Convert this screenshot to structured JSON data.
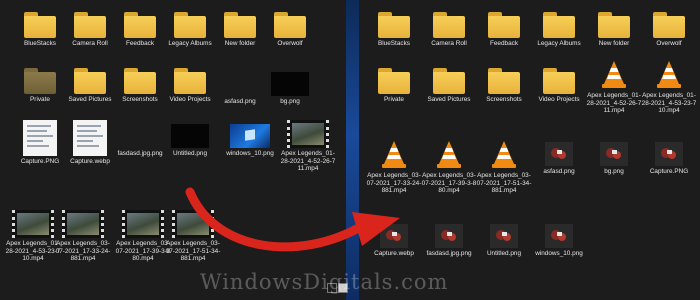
{
  "left_pane": {
    "items": [
      {
        "label": "BlueStacks",
        "kind": "folder"
      },
      {
        "label": "Camera Roll",
        "kind": "folder"
      },
      {
        "label": "Feedback",
        "kind": "folder"
      },
      {
        "label": "Legacy Albums",
        "kind": "folder"
      },
      {
        "label": "New folder",
        "kind": "folder"
      },
      {
        "label": "Overwolf",
        "kind": "folder"
      },
      {
        "label": "Private",
        "kind": "folder-dim"
      },
      {
        "label": "Saved Pictures",
        "kind": "folder"
      },
      {
        "label": "Screenshots",
        "kind": "folder"
      },
      {
        "label": "Video Projects",
        "kind": "folder"
      },
      {
        "label": "asfasd.png",
        "kind": "none"
      },
      {
        "label": "bg.png",
        "kind": "black"
      },
      {
        "label": "Capture.PNG",
        "kind": "doc"
      },
      {
        "label": "Capture.webp",
        "kind": "doc"
      },
      {
        "label": "fasdasd.jpg.png",
        "kind": "none"
      },
      {
        "label": "Untitled.png",
        "kind": "black"
      },
      {
        "label": "windows_10.png",
        "kind": "win10"
      },
      {
        "label": "Apex Legends_01-28-2021_4-52-26-711.mp4",
        "kind": "video"
      },
      {
        "label": "Apex Legends_01-28-2021_4-53-23-710.mp4",
        "kind": "video"
      },
      {
        "label": "Apex Legends_03-07-2021_17-33-24-881.mp4",
        "kind": "video"
      },
      {
        "label": "Apex Legends_03-07-2021_17-39-3-880.mp4",
        "kind": "video"
      },
      {
        "label": "Apex Legends_03-07-2021_17-51-34-881.mp4",
        "kind": "video"
      }
    ]
  },
  "right_pane": {
    "items": [
      {
        "label": "BlueStacks",
        "kind": "folder"
      },
      {
        "label": "Camera Roll",
        "kind": "folder"
      },
      {
        "label": "Feedback",
        "kind": "folder"
      },
      {
        "label": "Legacy Albums",
        "kind": "folder"
      },
      {
        "label": "New folder",
        "kind": "folder"
      },
      {
        "label": "Overwolf",
        "kind": "folder"
      },
      {
        "label": "Private",
        "kind": "folder"
      },
      {
        "label": "Saved Pictures",
        "kind": "folder"
      },
      {
        "label": "Screenshots",
        "kind": "folder"
      },
      {
        "label": "Video Projects",
        "kind": "folder"
      },
      {
        "label": "Apex Legends_01-28-2021_4-52-26-711.mp4",
        "kind": "vlc"
      },
      {
        "label": "Apex Legends_01-28-2021_4-53-23-710.mp4",
        "kind": "vlc"
      },
      {
        "label": "Apex Legends_03-07-2021_17-33-24-881.mp4",
        "kind": "vlc"
      },
      {
        "label": "Apex Legends_03-07-2021_17-39-3-880.mp4",
        "kind": "vlc"
      },
      {
        "label": "Apex Legends_03-07-2021_17-51-34-881.mp4",
        "kind": "vlc"
      },
      {
        "label": "asfasd.png",
        "kind": "ph"
      },
      {
        "label": "bg.png",
        "kind": "ph"
      },
      {
        "label": "Capture.PNG",
        "kind": "ph"
      },
      {
        "label": "Capture.webp",
        "kind": "ph"
      },
      {
        "label": "fasdasd.jpg.png",
        "kind": "ph"
      },
      {
        "label": "Untitled.png",
        "kind": "ph"
      },
      {
        "label": "windows_10.png",
        "kind": "ph"
      }
    ]
  },
  "watermark": "WindowsDigitals.com",
  "colors": {
    "arrow": "#d9251c",
    "folder": "#f2c14e",
    "pane_bg": "#1c1c1c",
    "gutter": "#1a4a9a"
  }
}
